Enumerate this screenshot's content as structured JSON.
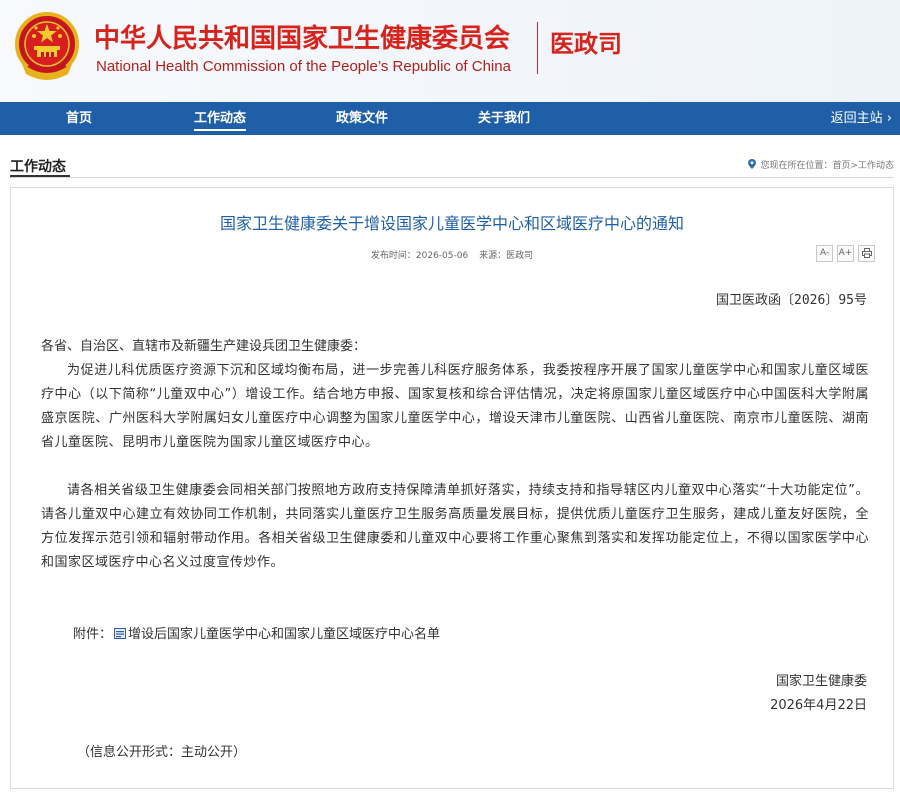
{
  "header": {
    "title_cn": "中华人民共和国国家卫生健康委员会",
    "title_en": "National Health Commission of the People’s Republic of China",
    "dept": "医政司",
    "brand_color": "#d6231c"
  },
  "nav": {
    "items": [
      {
        "label": "首页"
      },
      {
        "label": "工作动态"
      },
      {
        "label": "政策文件"
      },
      {
        "label": "关于我们"
      }
    ],
    "active": "工作动态",
    "back_label": "返回主站 ›",
    "color": "#1f5fa8"
  },
  "section": {
    "title": "工作动态",
    "location_label": "您现在所在位置：",
    "breadcrumb": "首页>工作动态"
  },
  "article": {
    "title": "国家卫生健康委关于增设国家儿童医学中心和区域医疗中心的通知",
    "publish_label": "发布时间：",
    "publish_date": "2026-05-06",
    "source_label": "来源：",
    "source": "医政司",
    "tools": [
      "A-",
      "A+",
      "print-icon"
    ],
    "doc_number": "国卫医政函〔2026〕95号",
    "salutation": "各省、自治区、直辖市及新疆生产建设兵团卫生健康委：",
    "paragraph1": "为促进儿科优质医疗资源下沉和区域均衡布局，进一步完善儿科医疗服务体系，我委按程序开展了国家儿童医学中心和国家儿童区域医疗中心（以下简称“儿童双中心”）增设工作。结合地方申报、国家复核和综合评估情况，决定将原国家儿童区域医疗中心中国医科大学附属盛京医院、广州医科大学附属妇女儿童医疗中心调整为国家儿童医学中心，增设天津市儿童医院、山西省儿童医院、南京市儿童医院、湖南省儿童医院、昆明市儿童医院为国家儿童区域医疗中心。",
    "paragraph2": "请各相关省级卫生健康委会同相关部门按照地方政府支持保障清单抓好落实，持续支持和指导辖区内儿童双中心落实“十大功能定位”。请各儿童双中心建立有效协同工作机制，共同落实儿童医疗卫生服务高质量发展目标，提供优质儿童医疗卫生服务，建成儿童友好医院，全方位发挥示范引领和辐射带动作用。各相关省级卫生健康委和儿童双中心要将工作重心聚焦到落实和发挥功能定位上，不得以国家医学中心和国家区域医疗中心名义过度宣传炒作。",
    "attachment_label": "附件：",
    "attachment_name": "增设后国家儿童医学中心和国家儿童区域医疗中心名单",
    "signer": "国家卫生健康委",
    "sign_date": "2026年4月22日",
    "disclosure": "（信息公开形式：主动公开）"
  }
}
